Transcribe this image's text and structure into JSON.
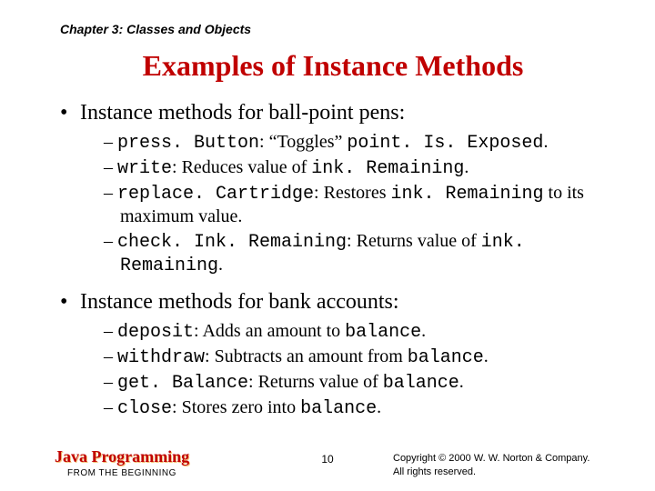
{
  "chapter": "Chapter 3: Classes and Objects",
  "title": "Examples of Instance Methods",
  "bullet1": "Instance methods for ball-point pens:",
  "pens": {
    "m0_a": "press. Button",
    "m0_b": ": “Toggles” ",
    "m0_c": "point. Is. Exposed",
    "m0_d": ".",
    "m1_a": "write",
    "m1_b": ": Reduces value of ",
    "m1_c": "ink. Remaining",
    "m1_d": ".",
    "m2_a": "replace. Cartridge",
    "m2_b": ": Restores ",
    "m2_c": "ink. Remaining",
    "m2_d": " to its maximum value.",
    "m3_a": "check. Ink. Remaining",
    "m3_b": ": Returns value of ",
    "m3_c": "ink. Remaining",
    "m3_d": "."
  },
  "bullet2": "Instance methods for bank accounts:",
  "bank": {
    "m0_a": "deposit",
    "m0_b": ": Adds an amount to ",
    "m0_c": "balance",
    "m0_d": ".",
    "m1_a": "withdraw",
    "m1_b": ": Subtracts an amount from ",
    "m1_c": "balance",
    "m1_d": ".",
    "m2_a": "get. Balance",
    "m2_b": ": Returns value of ",
    "m2_c": "balance",
    "m2_d": ".",
    "m3_a": "close",
    "m3_b": ": Stores zero into ",
    "m3_c": "balance",
    "m3_d": "."
  },
  "footer": {
    "brand_main": "Java Programming",
    "brand_sub": "FROM THE BEGINNING",
    "page": "10",
    "copy1": "Copyright © 2000 W. W. Norton & Company.",
    "copy2": "All rights reserved."
  }
}
